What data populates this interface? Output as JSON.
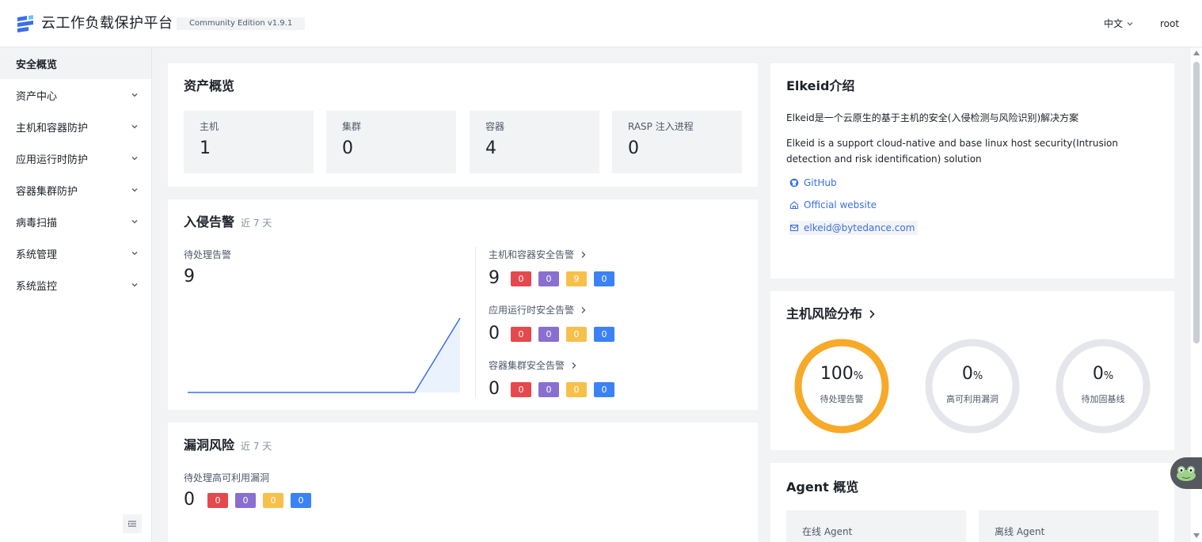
{
  "header": {
    "app_title": "云工作负载保护平台",
    "edition": "Community Edition v1.9.1",
    "language": "中文",
    "user": "root"
  },
  "sidebar": {
    "items": [
      {
        "label": "安全概览",
        "active": true
      },
      {
        "label": "资产中心"
      },
      {
        "label": "主机和容器防护"
      },
      {
        "label": "应用运行时防护"
      },
      {
        "label": "容器集群防护"
      },
      {
        "label": "病毒扫描"
      },
      {
        "label": "系统管理"
      },
      {
        "label": "系统监控"
      }
    ]
  },
  "asset_overview": {
    "title": "资产概览",
    "stats": [
      {
        "label": "主机",
        "value": "1"
      },
      {
        "label": "集群",
        "value": "0"
      },
      {
        "label": "容器",
        "value": "4"
      },
      {
        "label": "RASP 注入进程",
        "value": "0"
      }
    ]
  },
  "intrusion": {
    "title": "入侵告警",
    "period": "近 7 天",
    "pending_label": "待处理告警",
    "pending_value": "9",
    "groups": [
      {
        "label": "主机和容器安全告警",
        "total": "9",
        "counts": [
          "0",
          "0",
          "9",
          "0"
        ]
      },
      {
        "label": "应用运行时安全告警",
        "total": "0",
        "counts": [
          "0",
          "0",
          "0",
          "0"
        ]
      },
      {
        "label": "容器集群安全告警",
        "total": "0",
        "counts": [
          "0",
          "0",
          "0",
          "0"
        ]
      }
    ]
  },
  "chart_data": {
    "type": "area",
    "values": [
      0,
      0,
      0,
      0,
      0,
      0,
      9
    ]
  },
  "vuln": {
    "title": "漏洞风险",
    "period": "近 7 天",
    "pending_label": "待处理高可利用漏洞",
    "pending_value": "0",
    "counts": [
      "0",
      "0",
      "0",
      "0"
    ]
  },
  "elkeid": {
    "title": "Elkeid介绍",
    "desc_cn": "Elkeid是一个云原生的基于主机的安全(入侵检测与风险识别)解决方案",
    "desc_en": "Elkeid is a support cloud-native and base linux host security(Intrusion detection and risk identification) solution",
    "links": [
      {
        "label": "GitHub",
        "icon": "github-icon"
      },
      {
        "label": "Official website",
        "icon": "home-icon"
      },
      {
        "label": "elkeid@bytedance.com",
        "icon": "mail-icon"
      }
    ]
  },
  "host_risk": {
    "title": "主机风险分布",
    "rings": [
      {
        "value": "100",
        "unit": "%",
        "label": "待处理告警",
        "fraction": 1.0,
        "color": "#f7a928"
      },
      {
        "value": "0",
        "unit": "%",
        "label": "高可利用漏洞",
        "fraction": 0.0,
        "color": "#f7a928"
      },
      {
        "value": "0",
        "unit": "%",
        "label": "待加固基线",
        "fraction": 0.0,
        "color": "#f7a928"
      }
    ]
  },
  "agent": {
    "title": "Agent 概览",
    "online_label": "在线 Agent",
    "offline_label": "离线 Agent"
  },
  "colors": {
    "critical": "#e5484d",
    "high": "#8a6fd1",
    "medium": "#f7c04a",
    "low": "#3b82f6",
    "link": "#3b6fe8"
  }
}
